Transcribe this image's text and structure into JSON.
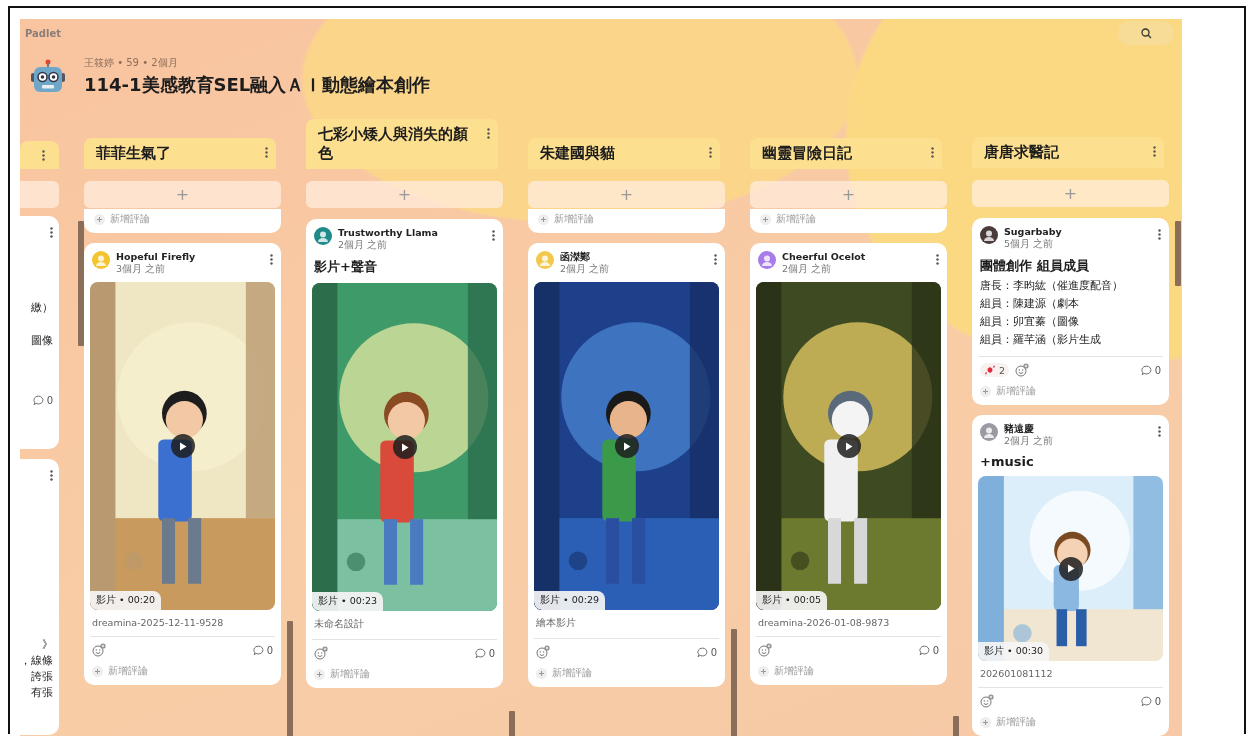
{
  "app": {
    "logo": "Padlet"
  },
  "board": {
    "meta": "王筱婷 • 59 • 2個月",
    "title": "114-1美感教育SEL融入ＡＩ動態繪本創作"
  },
  "partial_column": {
    "cards": [
      {
        "fragments": [
          "繳）",
          "圖像"
        ],
        "comments": "0"
      },
      {
        "fragments": [
          "》",
          "，線條",
          "誇張",
          "有張"
        ]
      }
    ]
  },
  "columns": [
    {
      "title": "菲菲生氣了",
      "add_label": "+",
      "posts": [
        {
          "kind": "stub",
          "add_comment": "新增評論"
        },
        {
          "kind": "video",
          "author": "Hopeful Firefly",
          "time": "3個月 之前",
          "badge": "影片 • 00:20",
          "caption": "dreamina-2025-12-11-9528",
          "comments": "0",
          "add_comment": "新增評論"
        }
      ]
    },
    {
      "title": "七彩小矮人與消失的顏色",
      "add_label": "+",
      "posts": [
        {
          "kind": "video",
          "author": "Trustworthy Llama",
          "time": "2個月 之前",
          "subject": "影片+聲音",
          "badge": "影片 • 00:23",
          "caption": "未命名設計",
          "comments": "0",
          "add_comment": "新增評論"
        }
      ]
    },
    {
      "title": "朱建國與貓",
      "add_label": "+",
      "posts": [
        {
          "kind": "stub",
          "add_comment": "新增評論"
        },
        {
          "kind": "video",
          "author": "函滐鄭",
          "time": "2個月 之前",
          "badge": "影片 • 00:29",
          "caption": "繪本影片",
          "comments": "0",
          "add_comment": "新增評論"
        }
      ]
    },
    {
      "title": "幽靈冒險日記",
      "add_label": "+",
      "posts": [
        {
          "kind": "stub",
          "add_comment": "新增評論"
        },
        {
          "kind": "video",
          "author": "Cheerful Ocelot",
          "time": "2個月 之前",
          "badge": "影片 • 00:05",
          "caption": "dreamina-2026-01-08-9873",
          "comments": "0",
          "add_comment": "新增評論"
        }
      ]
    },
    {
      "title": "唐唐求醫記",
      "add_label": "+",
      "posts": [
        {
          "kind": "text",
          "author": "Sugarbaby",
          "time": "5個月 之前",
          "subject": "團體創作 組員成員",
          "body": [
            "唐長：李昀紘（催進度配音）",
            "組員：陳建源（劇本",
            "組員：卯宜蓁（圖像",
            "組員：羅芊涵（影片生成"
          ],
          "reactions": [
            {
              "kind": "candy",
              "count": "2"
            }
          ],
          "comments": "0",
          "add_comment": "新增評論"
        },
        {
          "kind": "video",
          "author": "豬遠慶",
          "time": "2個月 之前",
          "subject": "+music",
          "badge": "影片 • 00:30",
          "caption": "202601081112",
          "comments": "0",
          "add_comment": "新增評論"
        }
      ]
    }
  ]
}
